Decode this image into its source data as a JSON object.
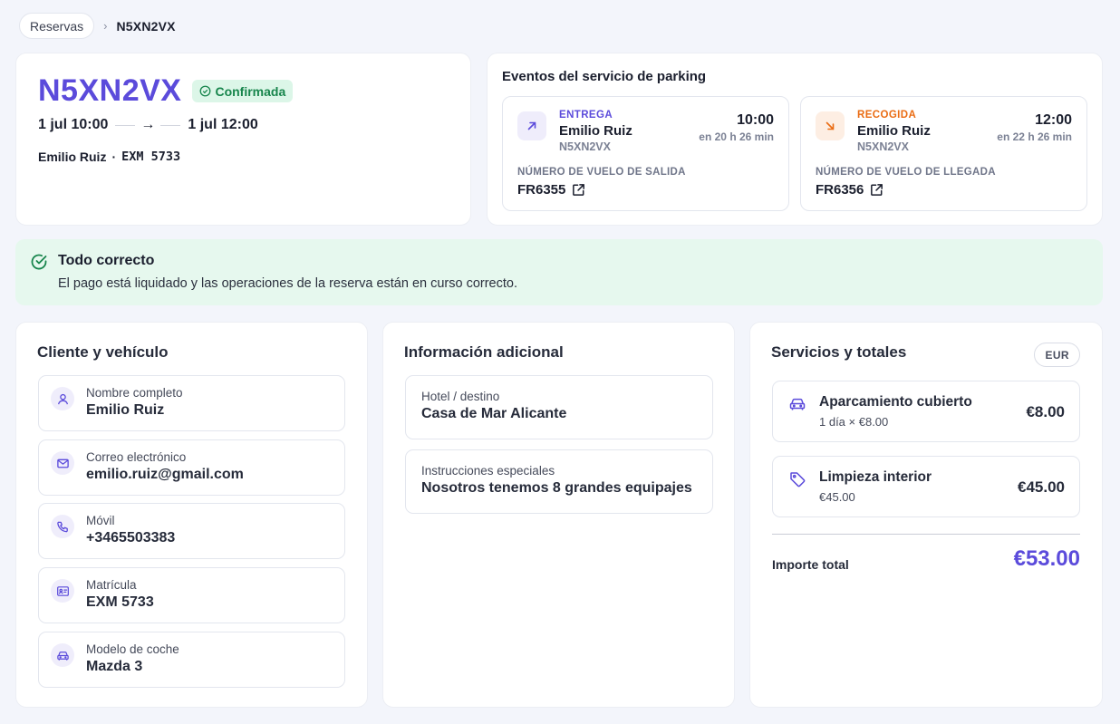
{
  "breadcrumb": {
    "parent": "Reservas",
    "separator": "›",
    "current": "N5XN2VX"
  },
  "booking": {
    "code": "N5XN2VX",
    "status": "Confirmada",
    "start": "1 jul 10:00",
    "arrow": "→",
    "end": "1 jul 12:00",
    "client": "Emilio Ruiz",
    "dot": "·",
    "plate": "EXM 5733"
  },
  "events": {
    "title": "Eventos del servicio de parking",
    "delivery": {
      "kind": "ENTREGA",
      "name": "Emilio Ruiz",
      "code": "N5XN2VX",
      "time": "10:00",
      "relative": "en 20 h 26 min",
      "flight_label": "NÚMERO DE VUELO DE SALIDA",
      "flight": "FR6355",
      "color": "#5b4bdb"
    },
    "pickup": {
      "kind": "RECOGIDA",
      "name": "Emilio Ruiz",
      "code": "N5XN2VX",
      "time": "12:00",
      "relative": "en 22 h 26 min",
      "flight_label": "NÚMERO DE VUELO DE LLEGADA",
      "flight": "FR6356",
      "color": "#ea6c13"
    }
  },
  "alert": {
    "title": "Todo correcto",
    "text": "El pago está liquidado y las operaciones de la reserva están en curso correcto."
  },
  "client_panel": {
    "title": "Cliente y vehículo",
    "fields": [
      {
        "label": "Nombre completo",
        "value": "Emilio Ruiz",
        "icon": "user-icon"
      },
      {
        "label": "Correo electrónico",
        "value": "emilio.ruiz@gmail.com",
        "icon": "mail-icon"
      },
      {
        "label": "Móvil",
        "value": "+3465503383",
        "icon": "phone-icon"
      },
      {
        "label": "Matrícula",
        "value": "EXM 5733",
        "icon": "id-card-icon"
      },
      {
        "label": "Modelo de coche",
        "value": "Mazda 3",
        "icon": "car-icon"
      }
    ]
  },
  "info_panel": {
    "title": "Información adicional",
    "fields": [
      {
        "label": "Hotel / destino",
        "value": "Casa de Mar Alicante"
      },
      {
        "label": "Instrucciones especiales",
        "value": "Nosotros tenemos 8 grandes equipajes"
      }
    ]
  },
  "totals_panel": {
    "title": "Servicios y totales",
    "currency": "EUR",
    "services": [
      {
        "name": "Aparcamiento cubierto",
        "detail": "1 día × €8.00",
        "price": "€8.00",
        "icon": "car-icon"
      },
      {
        "name": "Limpieza interior",
        "detail": "€45.00",
        "price": "€45.00",
        "icon": "tag-icon"
      }
    ],
    "total_label": "Importe total",
    "total_value": "€53.00"
  },
  "colors": {
    "accent": "#5b4bdb",
    "success": "#17854c",
    "success_bg": "#e6f8ee",
    "orange": "#ea6c13"
  }
}
